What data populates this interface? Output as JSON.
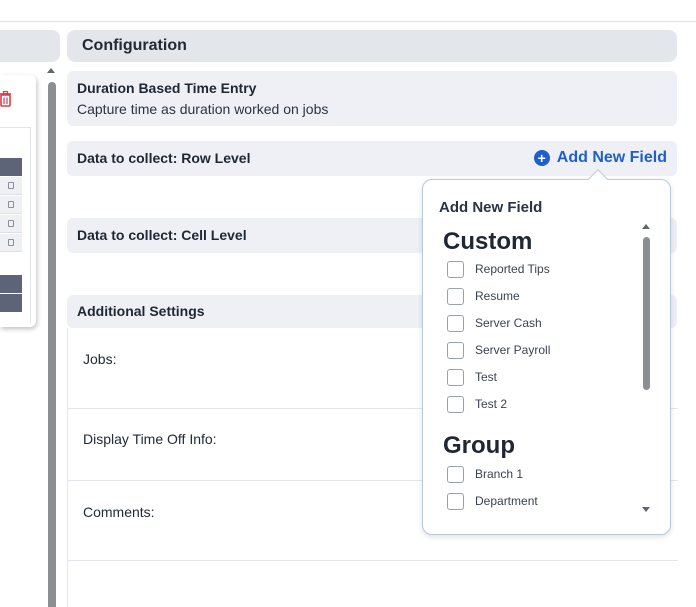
{
  "config": {
    "header": "Configuration",
    "duration": {
      "title": "Duration Based Time Entry",
      "description": "Capture time as duration worked on jobs"
    },
    "row_level": {
      "title": "Data to collect: Row Level",
      "add_field_label": "Add New Field"
    },
    "cell_level": {
      "title": "Data to collect: Cell Level"
    },
    "additional": {
      "title": "Additional Settings",
      "rows": [
        "Jobs:",
        "Display Time Off Info:",
        "Comments:"
      ]
    }
  },
  "popup": {
    "title": "Add New Field",
    "groups": [
      {
        "name": "Custom",
        "options": [
          "Reported Tips",
          "Resume",
          "Server Cash",
          "Server Payroll",
          "Test",
          "Test 2"
        ]
      },
      {
        "name": "Group",
        "options": [
          "Branch 1",
          "Department"
        ]
      }
    ]
  },
  "colors": {
    "accent": "#1e5fcc",
    "section_bg": "#eef0f6",
    "header_bg": "#e3e6ea",
    "delete_red": "#e0394a"
  },
  "icons": [
    "trash-icon",
    "plus-circle-icon",
    "scroll-up-arrow-icon",
    "scroll-down-arrow-icon"
  ]
}
